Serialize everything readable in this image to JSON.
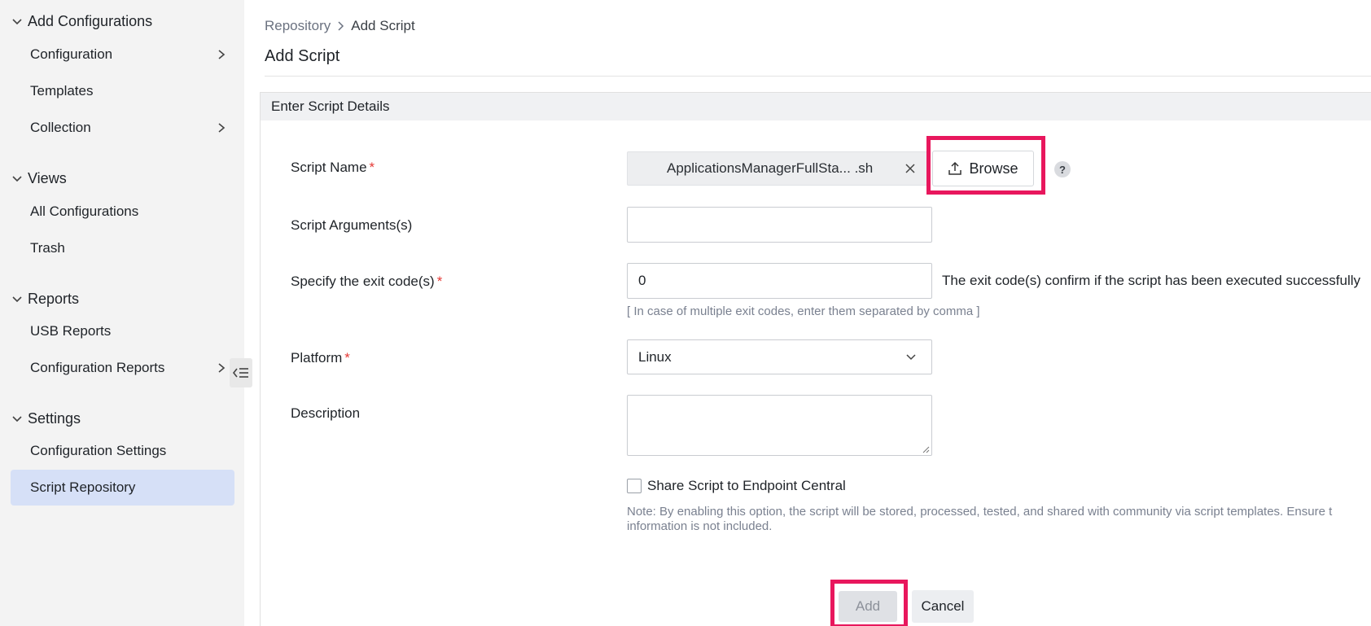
{
  "sidebar": {
    "sections": [
      {
        "title": "Add Configurations",
        "items": [
          {
            "label": "Configuration",
            "has_submenu": true
          },
          {
            "label": "Templates",
            "has_submenu": false
          },
          {
            "label": "Collection",
            "has_submenu": true
          }
        ]
      },
      {
        "title": "Views",
        "items": [
          {
            "label": "All Configurations",
            "has_submenu": false
          },
          {
            "label": "Trash",
            "has_submenu": false
          }
        ]
      },
      {
        "title": "Reports",
        "items": [
          {
            "label": "USB Reports",
            "has_submenu": false
          },
          {
            "label": "Configuration Reports",
            "has_submenu": true
          }
        ]
      },
      {
        "title": "Settings",
        "items": [
          {
            "label": "Configuration Settings",
            "has_submenu": false
          },
          {
            "label": "Script Repository",
            "has_submenu": false,
            "active": true
          }
        ]
      }
    ],
    "collapse_icon": "collapse-sidebar-icon"
  },
  "breadcrumb": {
    "parent": "Repository",
    "current": "Add Script"
  },
  "page_title": "Add Script",
  "panel_title": "Enter Script Details",
  "form": {
    "script_name": {
      "label": "Script Name",
      "required_mark": "*",
      "file_name": "ApplicationsManagerFullSta... .sh",
      "browse_label": "Browse",
      "help": "?"
    },
    "script_arguments": {
      "label": "Script Arguments(s)",
      "value": ""
    },
    "exit_code": {
      "label": "Specify the exit code(s)",
      "required_mark": "*",
      "value": "0",
      "note": "The exit code(s) confirm if the script has been executed successfully",
      "hint": "[ In case of multiple exit codes, enter them separated by comma ]"
    },
    "platform": {
      "label": "Platform",
      "required_mark": "*",
      "value": "Linux"
    },
    "description": {
      "label": "Description",
      "value": ""
    },
    "share": {
      "label": "Share Script to Endpoint Central",
      "checked": false,
      "note_line1": "Note: By enabling this option, the script will be stored, processed, tested, and shared with community via script templates. Ensure t",
      "note_line2": "information is not included."
    }
  },
  "actions": {
    "add_label": "Add",
    "cancel_label": "Cancel"
  },
  "colors": {
    "highlight": "#e8175d",
    "active_item": "#d6e0f7",
    "required": "#e53935"
  }
}
